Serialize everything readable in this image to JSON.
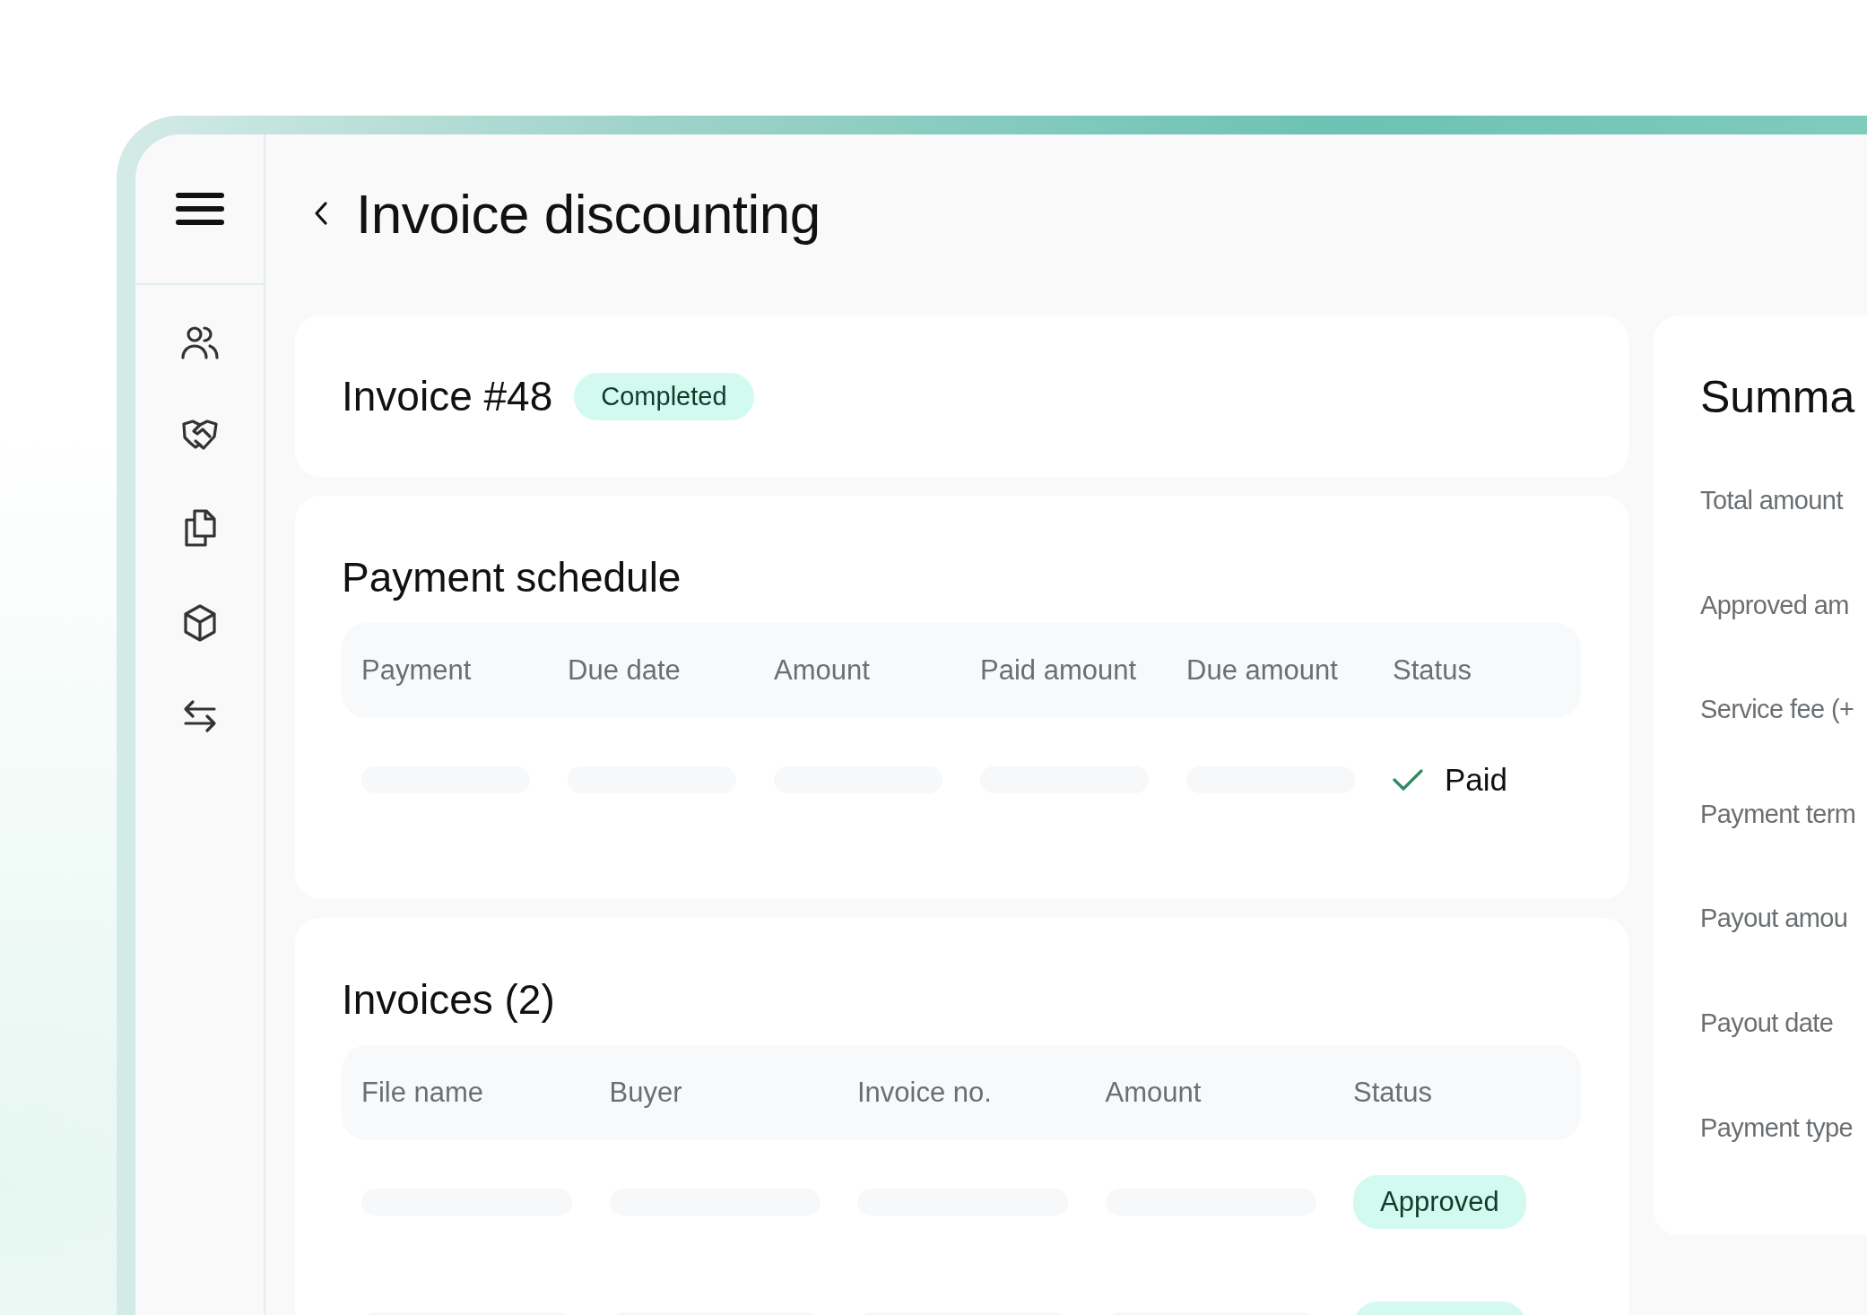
{
  "header": {
    "title": "Invoice discounting"
  },
  "invoice": {
    "title": "Invoice #48",
    "status": "Completed"
  },
  "payment_schedule": {
    "title": "Payment schedule",
    "columns": [
      "Payment",
      "Due date",
      "Amount",
      "Paid amount",
      "Due amount",
      "Status"
    ],
    "rows": [
      {
        "status": "Paid"
      }
    ]
  },
  "invoices": {
    "title": "Invoices (2)",
    "columns": [
      "File name",
      "Buyer",
      "Invoice no.",
      "Amount",
      "Status"
    ],
    "rows": [
      {
        "kind": "full",
        "status": "Approved"
      },
      {
        "kind": "cut"
      }
    ]
  },
  "summary": {
    "title": "Summa",
    "labels": [
      "Total amount",
      "Approved am",
      "Service fee (+",
      "Payment term",
      "Payout amou",
      "Payout date",
      "Payment type"
    ]
  }
}
